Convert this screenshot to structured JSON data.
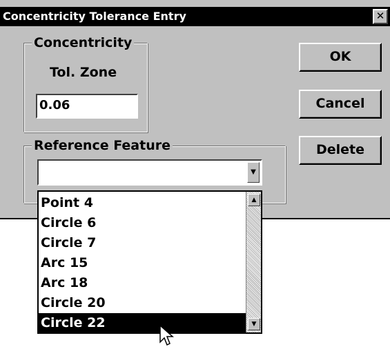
{
  "window": {
    "title": "Concentricity Tolerance Entry",
    "close_glyph": "✕"
  },
  "concentricity": {
    "group_title": "Concentricity",
    "tol_zone_label": "Tol. Zone",
    "tol_zone_value": "0.06"
  },
  "reference_feature": {
    "group_title": "Reference Feature",
    "selected_value": "",
    "dropdown_open": true,
    "options": [
      "Point 4",
      "Circle 6",
      "Circle 7",
      "Arc 15",
      "Arc 18",
      "Circle 20",
      "Circle 22"
    ],
    "highlighted_option": "Circle 22"
  },
  "buttons": {
    "ok": "OK",
    "cancel": "Cancel",
    "delete": "Delete"
  },
  "icons": {
    "combo_arrow": "chevron-down-icon",
    "scroll_up": "scroll-up-arrow-icon",
    "scroll_down": "scroll-down-arrow-icon",
    "cursor": "mouse-pointer-icon"
  },
  "colors": {
    "dialog_face": "#c0c0c0",
    "titlebar": "#000000",
    "selection": "#000000"
  }
}
